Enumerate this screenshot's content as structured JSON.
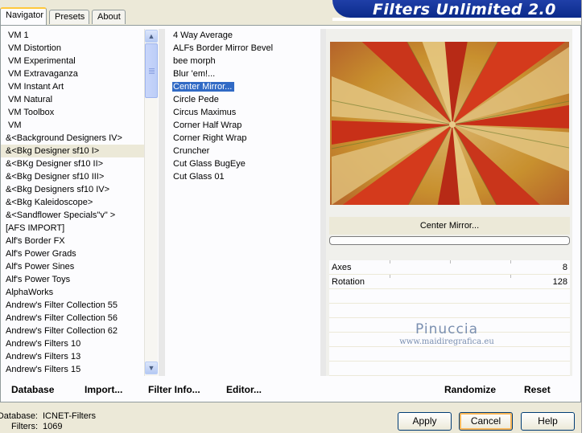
{
  "tabs": [
    {
      "label": "Navigator",
      "active": true
    },
    {
      "label": "Presets",
      "active": false
    },
    {
      "label": "About",
      "active": false
    }
  ],
  "banner": {
    "title": "Filters Unlimited 2.0"
  },
  "categories": [
    "VM 1",
    "VM Distortion",
    "VM Experimental",
    "VM Extravaganza",
    "VM Instant Art",
    "VM Natural",
    "VM Toolbox",
    "VM",
    "&<Background Designers IV>",
    "&<Bkg Designer sf10 I>",
    "&<BKg Designer sf10 II>",
    "&<Bkg Designer sf10 III>",
    "&<Bkg Designers sf10 IV>",
    "&<Bkg Kaleidoscope>",
    "&<Sandflower Specials\"v\" >",
    "[AFS IMPORT]",
    "Alf's Border FX",
    "Alf's Power Grads",
    "Alf's Power Sines",
    "Alf's Power Toys",
    "AlphaWorks",
    "Andrew's Filter Collection 55",
    "Andrew's Filter Collection 56",
    "Andrew's Filter Collection 62",
    "Andrew's Filters 10",
    "Andrew's Filters 13",
    "Andrew's Filters 15"
  ],
  "selected_category": "&<Bkg Designer sf10 I>",
  "filters": [
    "4 Way Average",
    "ALFs Border Mirror Bevel",
    "bee morph",
    "Blur 'em!...",
    "Center Mirror...",
    "Circle Pede",
    "Circus Maximus",
    "Corner Half Wrap",
    "Corner Right Wrap",
    "Cruncher",
    "Cut Glass  BugEye",
    "Cut Glass 01"
  ],
  "selected_filter": "Center Mirror...",
  "current_filter_name": "Center Mirror...",
  "parameters": [
    {
      "name": "Axes",
      "value": "8"
    },
    {
      "name": "Rotation",
      "value": "128"
    }
  ],
  "watermark": {
    "name": "Pinuccia",
    "url": "www.maidiregrafica.eu"
  },
  "toolbar": {
    "database": "Database",
    "import": "Import...",
    "filter_info": "Filter Info...",
    "editor": "Editor...",
    "randomize": "Randomize",
    "reset": "Reset"
  },
  "status": {
    "database_label": "Database:",
    "database_value": "ICNET-Filters",
    "filters_label": "Filters:",
    "filters_value": "1069"
  },
  "buttons": {
    "apply": "Apply",
    "cancel": "Cancel",
    "help": "Help"
  },
  "colors": {
    "accent": "#316ac5",
    "banner": "#0b2a8a",
    "face": "#ece9d8"
  }
}
